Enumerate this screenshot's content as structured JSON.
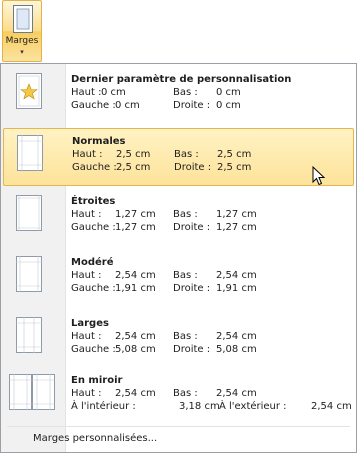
{
  "ribbon": {
    "label": "Marges",
    "arrow": "▾",
    "icon": "margins-icon"
  },
  "items": [
    {
      "title": "Dernier paramètre de personnalisation",
      "rows": [
        [
          "Haut :",
          "0 cm",
          "Bas :",
          "0 cm"
        ],
        [
          "Gauche :",
          "0 cm",
          "Droite :",
          "0 cm"
        ]
      ]
    },
    {
      "title": "Normales",
      "rows": [
        [
          "Haut :",
          "2,5 cm",
          "Bas :",
          "2,5 cm"
        ],
        [
          "Gauche :",
          "2,5 cm",
          "Droite :",
          "2,5 cm"
        ]
      ]
    },
    {
      "title": "Étroites",
      "rows": [
        [
          "Haut :",
          "1,27 cm",
          "Bas :",
          "1,27 cm"
        ],
        [
          "Gauche :",
          "1,27 cm",
          "Droite :",
          "1,27 cm"
        ]
      ]
    },
    {
      "title": "Modéré",
      "rows": [
        [
          "Haut :",
          "2,54 cm",
          "Bas :",
          "2,54 cm"
        ],
        [
          "Gauche :",
          "1,91 cm",
          "Droite :",
          "1,91 cm"
        ]
      ]
    },
    {
      "title": "Larges",
      "rows": [
        [
          "Haut :",
          "2,54 cm",
          "Bas :",
          "2,54 cm"
        ],
        [
          "Gauche :",
          "5,08 cm",
          "Droite :",
          "5,08 cm"
        ]
      ]
    },
    {
      "title": "En miroir",
      "rows": [
        [
          "Haut :",
          "2,54 cm",
          "Bas :",
          "2,54 cm"
        ],
        [
          "À l'intérieur :",
          "3,18 cm",
          "À l'extérieur :",
          "2,54 cm"
        ]
      ]
    }
  ],
  "custom_label": "Marges personnalisées...",
  "colors": {
    "highlight": "#fde39a",
    "highlight_border": "#e3b64f",
    "gutter": "#f1f1f1"
  }
}
